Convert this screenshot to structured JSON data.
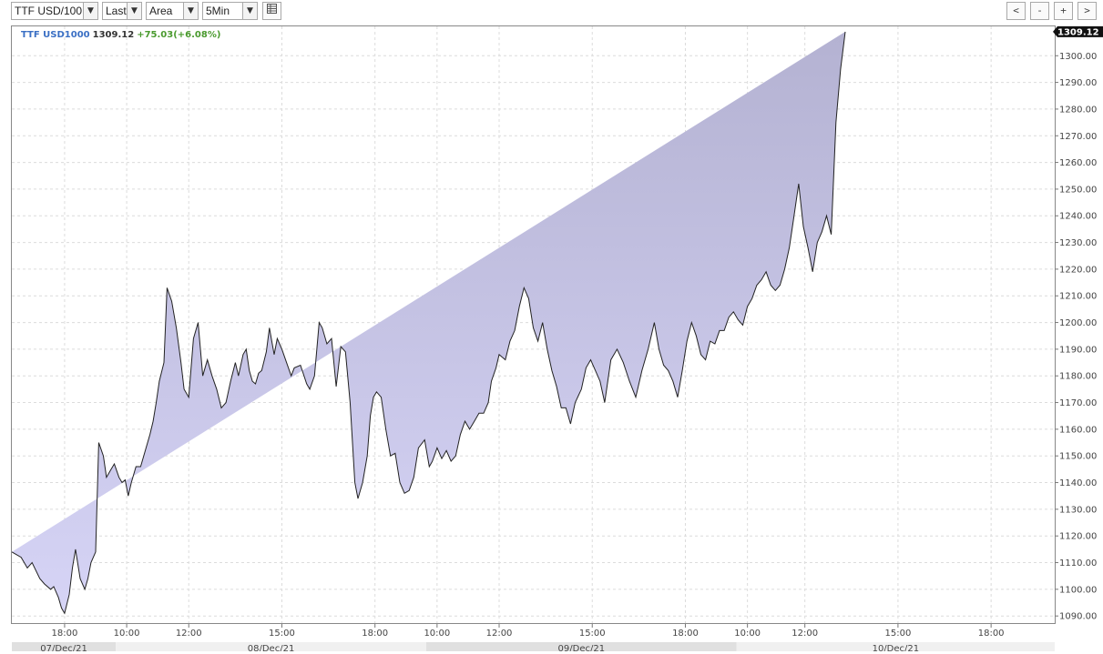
{
  "toolbar": {
    "symbol": "TTF USD/100",
    "price_field": "Last",
    "chart_style": "Area",
    "interval": "5Min",
    "table_icon": "table-icon",
    "nav_buttons": [
      "<",
      "-",
      "+",
      ">"
    ]
  },
  "legend": {
    "symbol": "TTF USD1000",
    "last": "1309.12",
    "change": "+75.03(+6.08%)"
  },
  "last_price_label": "1309.12",
  "colors": {
    "area_top": "#b4b2d2",
    "area_bottom": "#d6d4f6",
    "line": "#222222",
    "symbol": "#3a6fc4",
    "change": "#4a9a2e"
  },
  "chart_data": {
    "type": "area",
    "title": "",
    "xlabel": "",
    "ylabel": "",
    "ylim": [
      1087,
      1311
    ],
    "yticks": [
      1090,
      1100,
      1110,
      1120,
      1130,
      1140,
      1150,
      1160,
      1170,
      1180,
      1190,
      1200,
      1210,
      1220,
      1230,
      1240,
      1250,
      1260,
      1270,
      1280,
      1290,
      1300
    ],
    "ytick_labels": [
      "1090.00",
      "1100.00",
      "1110.00",
      "1120.00",
      "1130.00",
      "1140.00",
      "1150.00",
      "1160.00",
      "1170.00",
      "1180.00",
      "1190.00",
      "1200.00",
      "1210.00",
      "1220.00",
      "1230.00",
      "1240.00",
      "1250.00",
      "1260.00",
      "1270.00",
      "1280.00",
      "1290.00",
      "1300.00"
    ],
    "xticks": [
      {
        "x": 0.7,
        "label": "18:00"
      },
      {
        "x": 2.7,
        "label": "10:00"
      },
      {
        "x": 4.7,
        "label": "12:00"
      },
      {
        "x": 7.7,
        "label": "15:00"
      },
      {
        "x": 10.7,
        "label": "18:00"
      },
      {
        "x": 12.7,
        "label": "10:00"
      },
      {
        "x": 14.7,
        "label": "12:00"
      },
      {
        "x": 17.7,
        "label": "15:00"
      },
      {
        "x": 20.7,
        "label": "18:00"
      },
      {
        "x": 22.7,
        "label": "10:00"
      },
      {
        "x": 24.55,
        "label": "12:00"
      },
      {
        "x": 27.55,
        "label": "15:00"
      },
      {
        "x": 30.55,
        "label": "18:00"
      }
    ],
    "xlim": [
      -1,
      32.6
    ],
    "dates": [
      {
        "label": "07/Dec/21",
        "from": -1,
        "to": 2.35
      },
      {
        "label": "08/Dec/21",
        "from": 2.35,
        "to": 12.35
      },
      {
        "label": "09/Dec/21",
        "from": 12.35,
        "to": 22.35
      },
      {
        "label": "10/Dec/21",
        "from": 22.35,
        "to": 32.6
      }
    ],
    "x": [
      -1,
      -0.7,
      -0.5,
      -0.35,
      -0.1,
      0.05,
      0.25,
      0.35,
      0.5,
      0.6,
      0.7,
      0.85,
      0.95,
      1.05,
      1.2,
      1.35,
      1.45,
      1.55,
      1.7,
      1.8,
      1.95,
      2.05,
      2.2,
      2.3,
      2.45,
      2.55,
      2.65,
      2.75,
      2.85,
      3.0,
      3.15,
      3.3,
      3.45,
      3.55,
      3.65,
      3.75,
      3.9,
      4.0,
      4.15,
      4.3,
      4.45,
      4.55,
      4.7,
      4.85,
      5.0,
      5.15,
      5.3,
      5.45,
      5.6,
      5.75,
      5.9,
      6.05,
      6.2,
      6.3,
      6.45,
      6.55,
      6.65,
      6.75,
      6.85,
      6.95,
      7.05,
      7.2,
      7.3,
      7.45,
      7.55,
      7.7,
      7.85,
      8.0,
      8.1,
      8.3,
      8.5,
      8.6,
      8.75,
      8.9,
      9.0,
      9.15,
      9.3,
      9.45,
      9.6,
      9.75,
      9.9,
      10.05,
      10.15,
      10.3,
      10.45,
      10.55,
      10.65,
      10.75,
      10.9,
      11.05,
      11.2,
      11.35,
      11.5,
      11.65,
      11.8,
      11.95,
      12.1,
      12.3,
      12.45,
      12.55,
      12.7,
      12.85,
      13.0,
      13.15,
      13.3,
      13.45,
      13.6,
      13.75,
      13.9,
      14.05,
      14.2,
      14.35,
      14.45,
      14.6,
      14.7,
      14.9,
      15.05,
      15.2,
      15.35,
      15.5,
      15.65,
      15.8,
      15.95,
      16.1,
      16.25,
      16.4,
      16.55,
      16.7,
      16.85,
      17.0,
      17.15,
      17.35,
      17.5,
      17.65,
      17.8,
      17.95,
      18.1,
      18.3,
      18.5,
      18.7,
      18.9,
      19.1,
      19.3,
      19.5,
      19.7,
      19.85,
      20.0,
      20.15,
      20.3,
      20.45,
      20.6,
      20.75,
      20.9,
      21.05,
      21.2,
      21.35,
      21.5,
      21.65,
      21.8,
      21.95,
      22.1,
      22.25,
      22.4,
      22.55,
      22.7,
      22.85,
      23.0,
      23.15,
      23.3,
      23.45,
      23.6,
      23.75,
      23.9,
      24.05,
      24.2,
      24.35,
      24.5,
      24.65,
      24.8,
      24.95,
      25.1,
      25.25,
      25.4,
      25.55,
      25.7,
      25.85,
      26.0,
      26.2,
      26.35,
      26.5,
      26.65,
      26.8,
      26.95,
      27.1,
      27.25,
      27.4,
      27.6,
      27.75,
      27.9,
      28.1,
      28.3,
      28.5,
      28.7,
      28.9,
      29.1,
      29.3,
      29.5,
      29.7,
      29.9,
      30.1,
      30.3,
      30.5,
      30.65,
      30.8,
      30.95,
      31.1,
      31.25,
      31.4,
      31.55,
      31.7,
      31.85,
      32.0,
      32.15,
      32.3,
      32.45
    ],
    "series": [
      {
        "values": [
          1114,
          1112,
          1108,
          1110,
          1104,
          1102,
          1100,
          1101,
          1097,
          1093,
          1091,
          1098,
          1108,
          1115,
          1104,
          1100,
          1104,
          1110,
          1114,
          1155,
          1150,
          1142,
          1145,
          1147,
          1142,
          1140,
          1141,
          1135,
          1140,
          1146,
          1146,
          1152,
          1158,
          1163,
          1170,
          1178,
          1185,
          1213,
          1208,
          1198,
          1185,
          1175,
          1172,
          1194,
          1200,
          1180,
          1186,
          1180,
          1175,
          1168,
          1170,
          1178,
          1185,
          1180,
          1188,
          1190,
          1182,
          1178,
          1177,
          1181,
          1182,
          1189,
          1198,
          1188,
          1194,
          1190,
          1185,
          1180,
          1183,
          1184,
          1177,
          1175,
          1180,
          1200,
          1198,
          1192,
          1194,
          1176,
          1191,
          1189,
          1170,
          1140,
          1134,
          1140,
          1150,
          1165,
          1172,
          1174,
          1172,
          1160,
          1150,
          1151,
          1140,
          1136,
          1137,
          1142,
          1153,
          1156,
          1146,
          1148,
          1153,
          1149,
          1152,
          1148,
          1150,
          1158,
          1163,
          1160,
          1163,
          1166,
          1166,
          1170,
          1178,
          1183,
          1188,
          1186,
          1193,
          1197,
          1206,
          1213,
          1209,
          1198,
          1193,
          1200,
          1190,
          1182,
          1176,
          1168,
          1168,
          1162,
          1170,
          1175,
          1183,
          1186,
          1182,
          1178,
          1170,
          1186,
          1190,
          1185,
          1178,
          1172,
          1182,
          1190,
          1200,
          1190,
          1184,
          1182,
          1178,
          1172,
          1182,
          1193,
          1200,
          1195,
          1188,
          1186,
          1193,
          1192,
          1197,
          1197,
          1202,
          1204,
          1201,
          1199,
          1206,
          1209,
          1214,
          1216,
          1219,
          1214,
          1212,
          1214,
          1220,
          1228,
          1240,
          1252,
          1236,
          1228,
          1219,
          1230,
          1234,
          1240,
          1233,
          1275,
          1295,
          1309
        ]
      }
    ],
    "grid": true,
    "legend": "top-left"
  }
}
